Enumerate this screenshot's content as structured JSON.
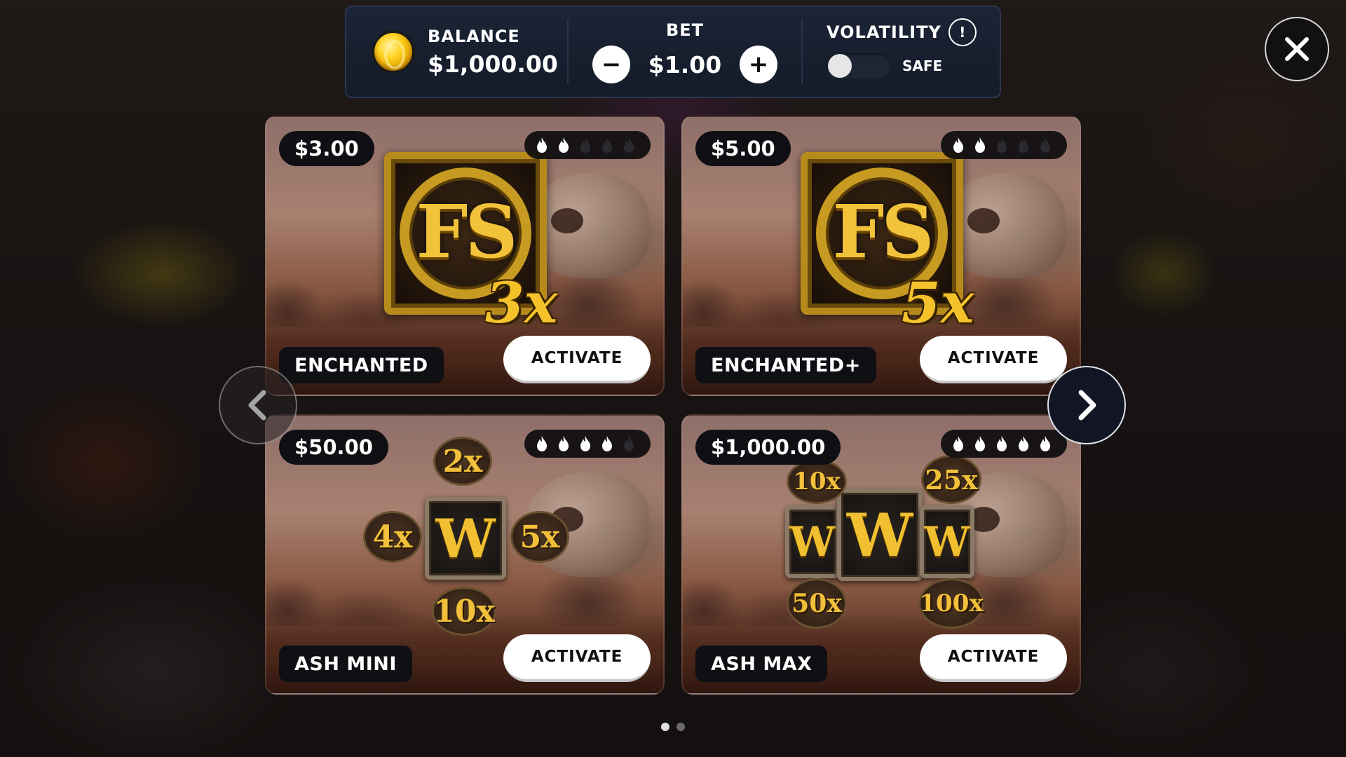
{
  "topbar": {
    "balance_label": "BALANCE",
    "balance_value": "$1,000.00",
    "bet_label": "BET",
    "bet_value": "$1.00",
    "bet_decrease_label": "−",
    "bet_increase_label": "+",
    "volatility_label": "VOLATILITY",
    "volatility_info": "!",
    "volatility_status": "SAFE",
    "volatility_toggle_on": false
  },
  "cards": [
    {
      "price": "$3.00",
      "name": "ENCHANTED",
      "activate_label": "ACTIVATE",
      "volatility_level": 2,
      "volatility_max": 5,
      "art": {
        "type": "free-spins",
        "emblem_text": "FS",
        "multiplier": "3x"
      }
    },
    {
      "price": "$5.00",
      "name": "ENCHANTED+",
      "activate_label": "ACTIVATE",
      "volatility_level": 2,
      "volatility_max": 5,
      "art": {
        "type": "free-spins",
        "emblem_text": "FS",
        "multiplier": "5x"
      }
    },
    {
      "price": "$50.00",
      "name": "ASH MINI",
      "activate_label": "ACTIVATE",
      "volatility_level": 4,
      "volatility_max": 5,
      "art": {
        "type": "wild",
        "wild_text": "W",
        "multipliers": [
          "2x",
          "4x",
          "5x",
          "10x"
        ]
      }
    },
    {
      "price": "$1,000.00",
      "name": "ASH MAX",
      "activate_label": "ACTIVATE",
      "volatility_level": 5,
      "volatility_max": 5,
      "art": {
        "type": "wild",
        "wild_text": "W",
        "multipliers": [
          "10x",
          "25x",
          "50x",
          "100x"
        ]
      }
    }
  ],
  "pagination": {
    "current_page": 1,
    "total_pages": 2
  },
  "icons": {
    "coin": "coin-icon",
    "close": "close-icon",
    "prev": "chevron-left-icon",
    "next": "chevron-right-icon",
    "flame": "flame-icon"
  },
  "colors": {
    "topbar_bg": "#141b29",
    "flame_active": "#ffffff",
    "flame_inactive": "#2a2a30",
    "gold": "#f2c23a",
    "dot_active": "#e0e0e0",
    "dot_inactive": "#6a6a6a"
  }
}
